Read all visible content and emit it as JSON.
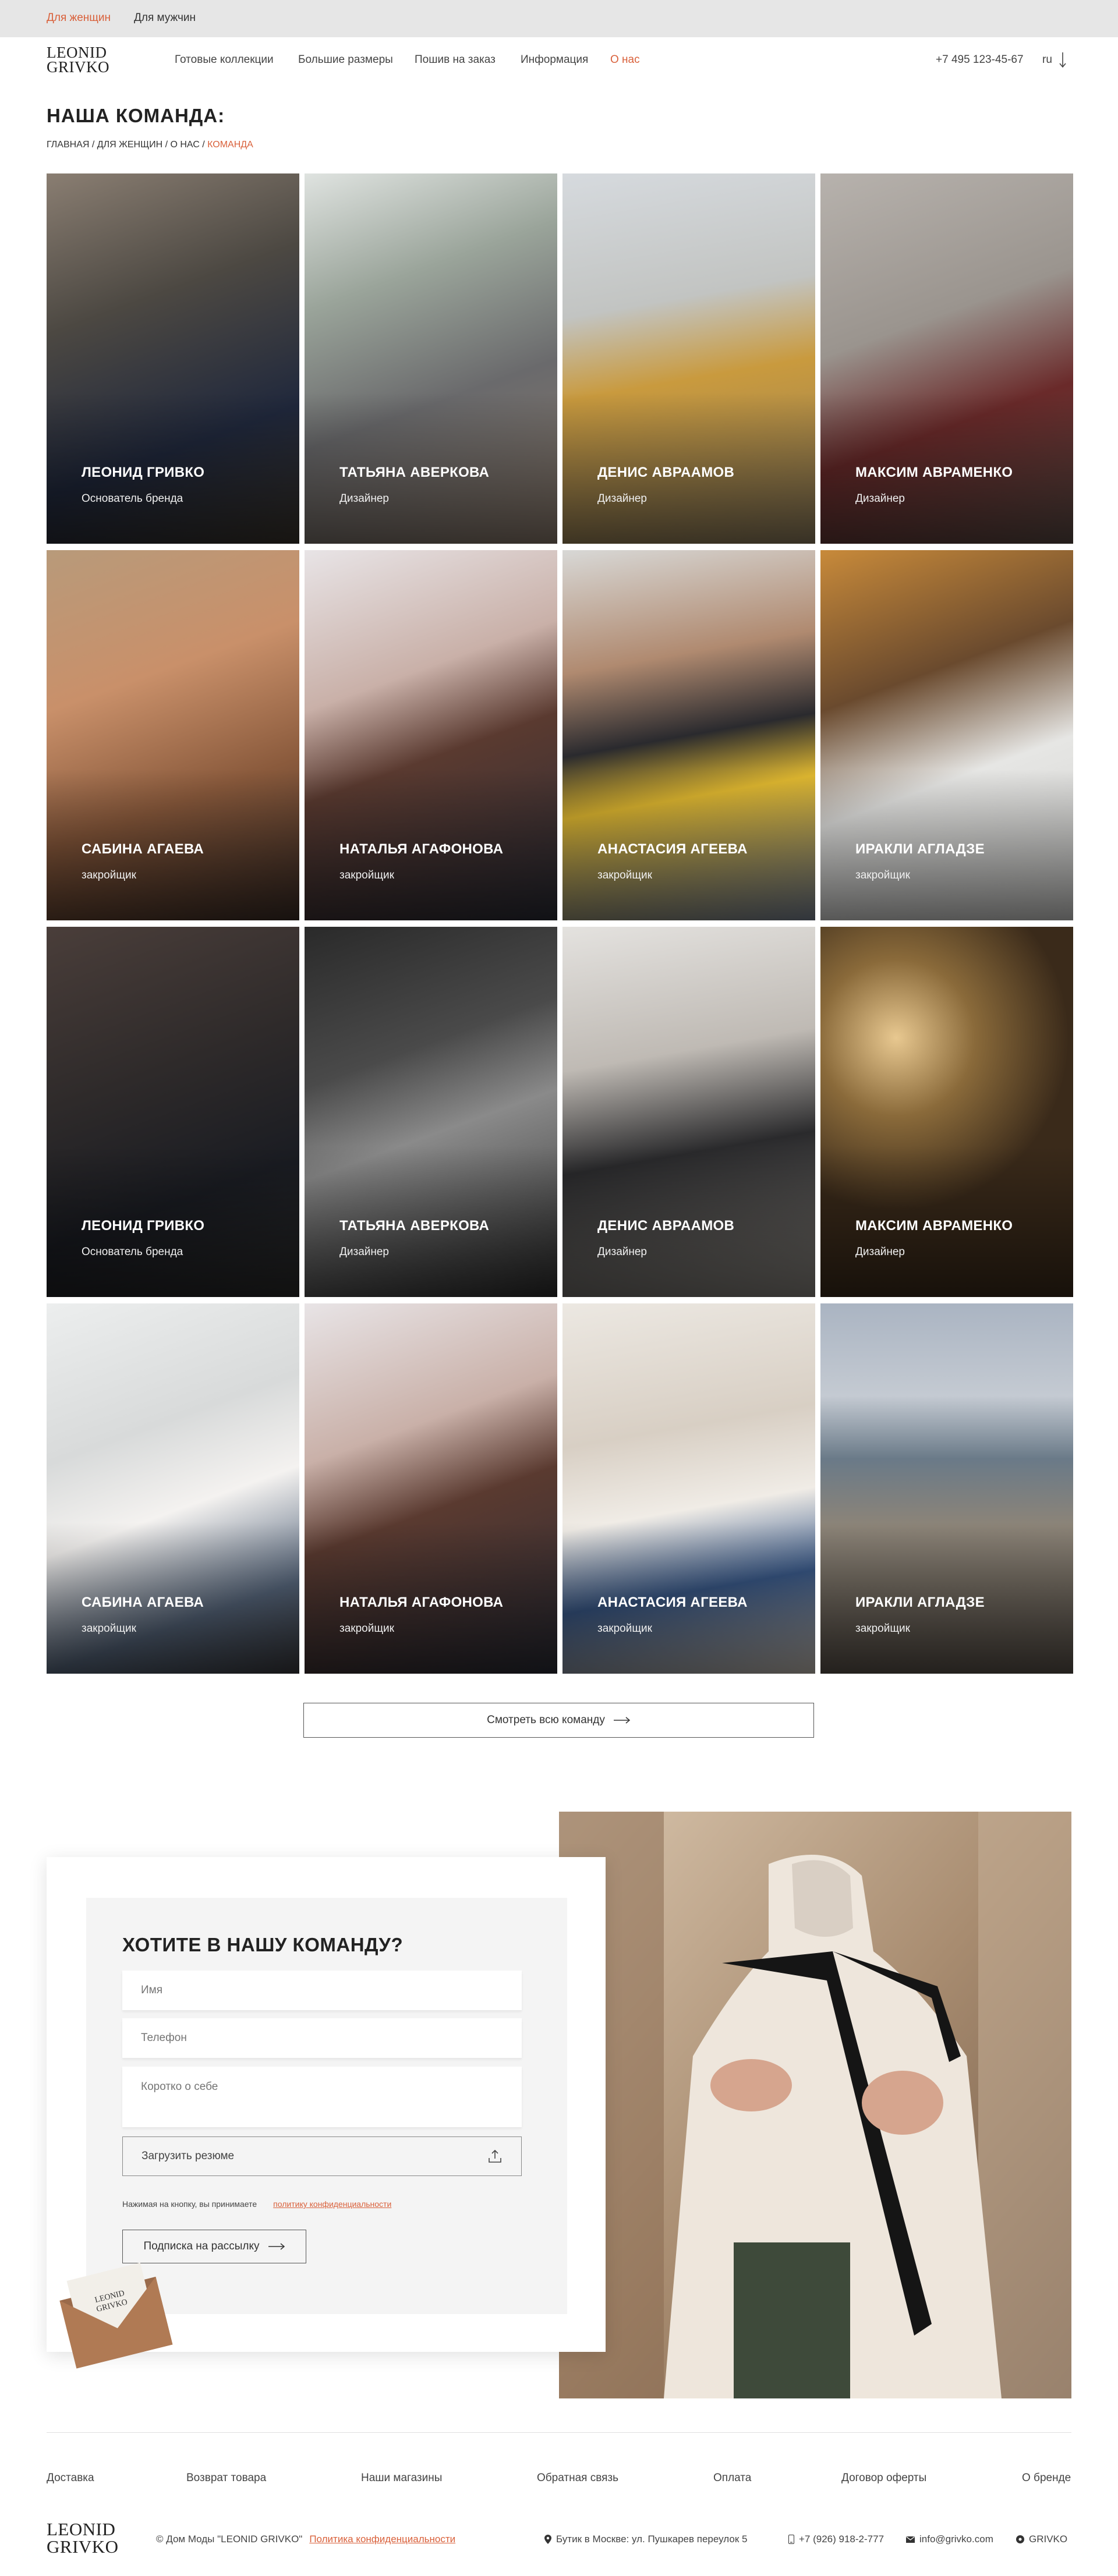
{
  "topbar": {
    "women": "Для женщин",
    "men": "Для мужчин"
  },
  "logo": {
    "line1": "LEONID",
    "line2": "GRIVKO"
  },
  "nav": {
    "items": [
      "Готовые коллекции",
      "Большие размеры",
      "Пошив на заказ",
      "Информация",
      "О нас"
    ],
    "phone": "+7 495 123-45-67",
    "lang": "ru"
  },
  "page": {
    "title": "НАША КОМАНДА:"
  },
  "breadcrumb": {
    "home": "ГЛАВНАЯ",
    "women": "ДЛЯ ЖЕНЩИН",
    "about": "О НАС",
    "current": "КОМАНДА",
    "sep": " / "
  },
  "team": [
    {
      "name": "ЛЕОНИД ГРИВКО",
      "role": "Основатель бренда"
    },
    {
      "name": "ТАТЬЯНА АВЕРКОВА",
      "role": "Дизайнер"
    },
    {
      "name": "ДЕНИС АВРААМОВ",
      "role": "Дизайнер"
    },
    {
      "name": "МАКСИМ АВРАМЕНКО",
      "role": "Дизайнер"
    },
    {
      "name": "САБИНА АГАЕВА",
      "role": "закройщик"
    },
    {
      "name": "НАТАЛЬЯ АГАФОНОВА",
      "role": "закройщик"
    },
    {
      "name": "АНАСТАСИЯ АГЕЕВА",
      "role": "закройщик"
    },
    {
      "name": "ИРАКЛИ АГЛАДЗЕ",
      "role": "закройщик"
    },
    {
      "name": "ЛЕОНИД ГРИВКО",
      "role": "Основатель бренда"
    },
    {
      "name": "ТАТЬЯНА АВЕРКОВА",
      "role": "Дизайнер"
    },
    {
      "name": "ДЕНИС АВРААМОВ",
      "role": "Дизайнер"
    },
    {
      "name": "МАКСИМ АВРАМЕНКО",
      "role": "Дизайнер"
    },
    {
      "name": "САБИНА АГАЕВА",
      "role": "закройщик"
    },
    {
      "name": "НАТАЛЬЯ АГАФОНОВА",
      "role": "закройщик"
    },
    {
      "name": "АНАСТАСИЯ АГЕЕВА",
      "role": "закройщик"
    },
    {
      "name": "ИРАКЛИ АГЛАДЗЕ",
      "role": "закройщик"
    }
  ],
  "view_all": "Смотреть всю команду",
  "join": {
    "title": "ХОТИТЕ В НАШУ КОМАНДУ?",
    "name_placeholder": "Имя",
    "phone_placeholder": "Телефон",
    "about_placeholder": "Коротко о себе",
    "upload": "Загрузить резюме",
    "agree": "Нажимая на кнопку, вы принимаете",
    "policy": "политику конфиденциальности",
    "subscribe": "Подписка на рассылку"
  },
  "footer": {
    "links": [
      "Доставка",
      "Возврат товара",
      "Наши магазины",
      "Обратная связь",
      "Оплата",
      "Договор оферты",
      "О бренде"
    ],
    "copyright": "© Дом Моды \"LEONID GRIVKO\"",
    "privacy": "Политика конфиденциальности",
    "address": "Бутик в Москве: ул. Пушкарев переулок 5",
    "phone": "+7 (926) 918-2-777",
    "email": "info@grivko.com",
    "brand": "GRIVKO"
  },
  "colors": {
    "accent": "#d9603a",
    "topbar_bg": "#e6e6e6"
  }
}
